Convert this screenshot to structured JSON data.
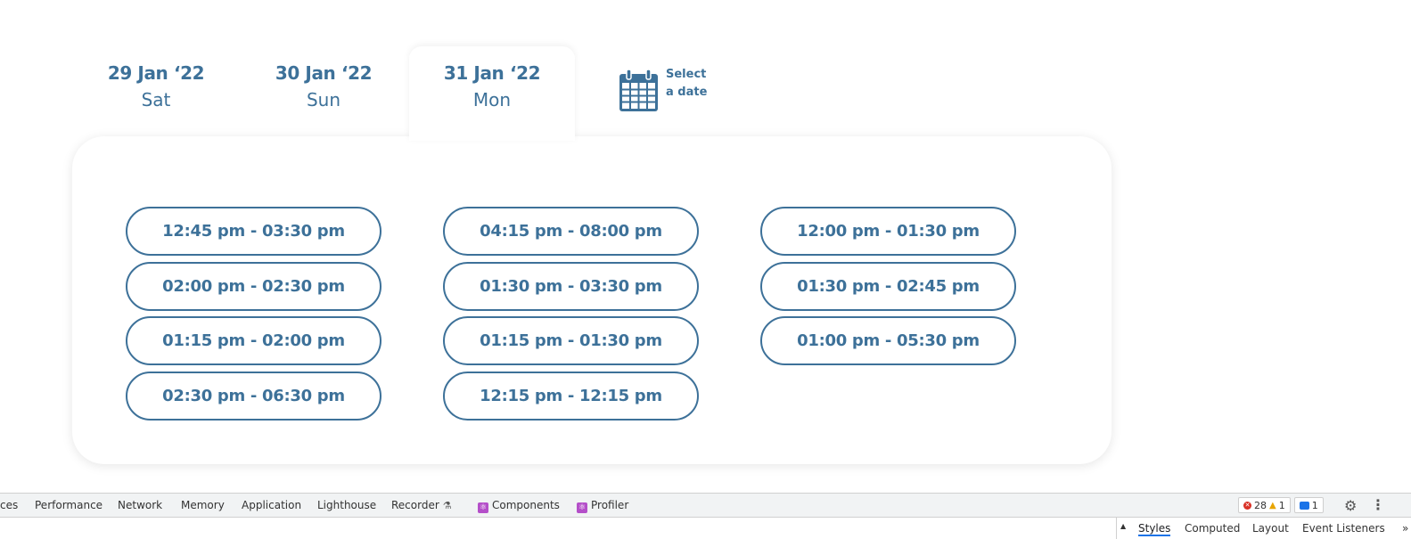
{
  "date_tabs": [
    {
      "date": "29 Jan ‘22",
      "day": "Sat",
      "active": false
    },
    {
      "date": "30 Jan ‘22",
      "day": "Sun",
      "active": false
    },
    {
      "date": "31 Jan ‘22",
      "day": "Mon",
      "active": true
    }
  ],
  "select_date": {
    "line1": "Select",
    "line2": "a date",
    "icon": "calendar-icon"
  },
  "slots": {
    "column1": [
      "12:45 pm - 03:30 pm",
      "02:00 pm - 02:30 pm",
      "01:15 pm - 02:00 pm",
      "02:30 pm - 06:30 pm"
    ],
    "column2": [
      "04:15 pm - 08:00 pm",
      "01:30 pm - 03:30 pm",
      "01:15 pm - 01:30 pm",
      "12:15 pm - 12:15 pm"
    ],
    "column3": [
      "12:00 pm - 01:30 pm",
      "01:30 pm - 02:45 pm",
      "01:00 pm - 05:30 pm"
    ]
  },
  "colors": {
    "accent": "#3d7199"
  },
  "devtools": {
    "tabs": [
      "ces",
      "Performance",
      "Network",
      "Memory",
      "Application",
      "Lighthouse",
      "Recorder",
      "Components",
      "Profiler"
    ],
    "errors": "28",
    "warnings": "1",
    "messages": "1",
    "subtabs": [
      "Styles",
      "Computed",
      "Layout",
      "Event Listeners"
    ],
    "subtab_more": "»"
  }
}
